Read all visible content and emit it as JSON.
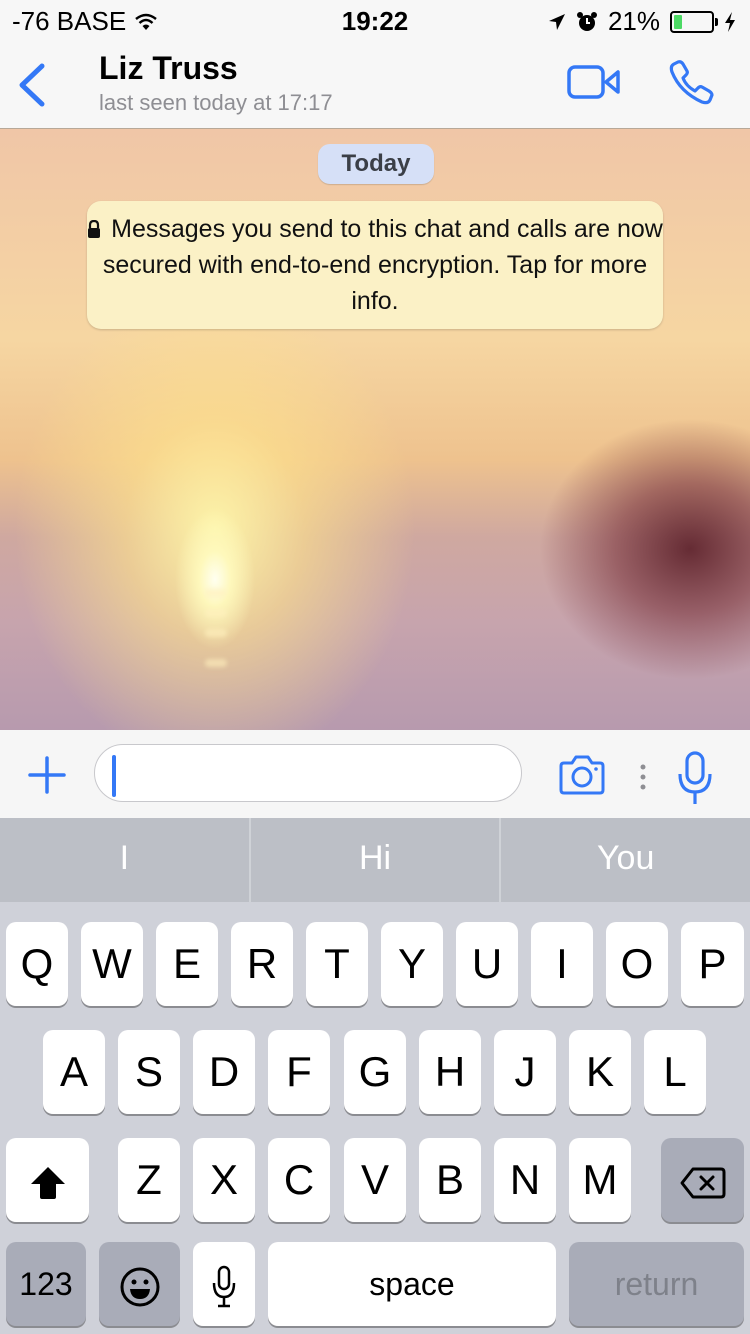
{
  "status_bar": {
    "carrier": "-76 BASE",
    "time": "19:22",
    "battery_percent_label": "21%",
    "battery_level": 0.21,
    "icons": [
      "wifi-icon",
      "location-arrow-icon",
      "alarm-icon",
      "battery-icon",
      "charging-bolt-icon"
    ]
  },
  "header": {
    "contact_name": "Liz Truss",
    "contact_status": "last seen today at 17:17",
    "actions": [
      "back-chevron-icon",
      "video-call-icon",
      "phone-call-icon"
    ],
    "accent_color": "#3478f6"
  },
  "chat": {
    "date_separator": "Today",
    "system_notice": "Messages you send to this chat and calls are now secured with end-to-end encryption. Tap for more info.",
    "notice_icon": "lock-icon"
  },
  "composer": {
    "value": "",
    "placeholder": "",
    "icons": [
      "plus-icon",
      "camera-icon",
      "more-dots-icon",
      "microphone-icon"
    ]
  },
  "predictions": [
    "I",
    "Hi",
    "You"
  ],
  "keyboard": {
    "row1": [
      "Q",
      "W",
      "E",
      "R",
      "T",
      "Y",
      "U",
      "I",
      "O",
      "P"
    ],
    "row2": [
      "A",
      "S",
      "D",
      "F",
      "G",
      "H",
      "J",
      "K",
      "L"
    ],
    "row3": [
      "Z",
      "X",
      "C",
      "V",
      "B",
      "N",
      "M"
    ],
    "numbers_label": "123",
    "space_label": "space",
    "return_label": "return",
    "icons": [
      "shift-icon",
      "backspace-icon",
      "emoji-icon",
      "dictation-mic-icon"
    ]
  }
}
